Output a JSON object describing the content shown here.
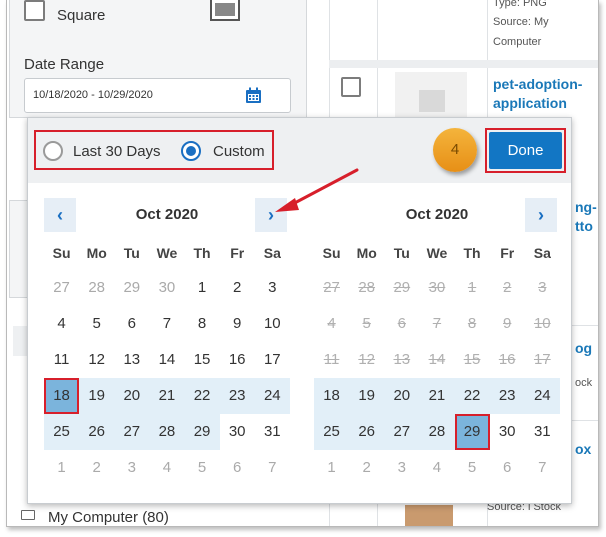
{
  "filters": {
    "square_label": "Square",
    "date_range_label": "Date Range",
    "date_range_value": "10/18/2020 - 10/29/2020",
    "my_computer_label": "My Computer (80)"
  },
  "files": {
    "row1_type": "Type: PNG",
    "row1_source": "Source: My",
    "row1_source2": "Computer",
    "row2_name_line1": "pet-adoption-",
    "row2_name_line2": "application",
    "row3_name_line1": "ng-",
    "row3_name_line2": "tto",
    "row4_name": "og",
    "row4_meta": "ock",
    "row5_name": "ox",
    "row5_meta": "Source: i Stock"
  },
  "picker": {
    "range_options": [
      {
        "label": "Last 30 Days",
        "selected": false
      },
      {
        "label": "Custom",
        "selected": true
      }
    ],
    "step_number": "4",
    "done_label": "Done",
    "prev_glyph": "‹",
    "next_glyph": "›",
    "weekdays": [
      "Su",
      "Mo",
      "Tu",
      "We",
      "Th",
      "Fr",
      "Sa"
    ],
    "months": [
      {
        "title": "Oct 2020",
        "weeks": [
          [
            {
              "d": "27",
              "s": "muted"
            },
            {
              "d": "28",
              "s": "muted"
            },
            {
              "d": "29",
              "s": "muted"
            },
            {
              "d": "30",
              "s": "muted"
            },
            {
              "d": "1",
              "s": ""
            },
            {
              "d": "2",
              "s": ""
            },
            {
              "d": "3",
              "s": ""
            }
          ],
          [
            {
              "d": "4",
              "s": ""
            },
            {
              "d": "5",
              "s": ""
            },
            {
              "d": "6",
              "s": ""
            },
            {
              "d": "7",
              "s": ""
            },
            {
              "d": "8",
              "s": ""
            },
            {
              "d": "9",
              "s": ""
            },
            {
              "d": "10",
              "s": ""
            }
          ],
          [
            {
              "d": "11",
              "s": ""
            },
            {
              "d": "12",
              "s": ""
            },
            {
              "d": "13",
              "s": ""
            },
            {
              "d": "14",
              "s": ""
            },
            {
              "d": "15",
              "s": ""
            },
            {
              "d": "16",
              "s": ""
            },
            {
              "d": "17",
              "s": ""
            }
          ],
          [
            {
              "d": "18",
              "s": "sel"
            },
            {
              "d": "19",
              "s": "range"
            },
            {
              "d": "20",
              "s": "range"
            },
            {
              "d": "21",
              "s": "range"
            },
            {
              "d": "22",
              "s": "range"
            },
            {
              "d": "23",
              "s": "range"
            },
            {
              "d": "24",
              "s": "range"
            }
          ],
          [
            {
              "d": "25",
              "s": "range"
            },
            {
              "d": "26",
              "s": "range"
            },
            {
              "d": "27",
              "s": "range"
            },
            {
              "d": "28",
              "s": "range"
            },
            {
              "d": "29",
              "s": "range"
            },
            {
              "d": "30",
              "s": ""
            },
            {
              "d": "31",
              "s": ""
            }
          ],
          [
            {
              "d": "1",
              "s": "muted"
            },
            {
              "d": "2",
              "s": "muted"
            },
            {
              "d": "3",
              "s": "muted"
            },
            {
              "d": "4",
              "s": "muted"
            },
            {
              "d": "5",
              "s": "muted"
            },
            {
              "d": "6",
              "s": "muted"
            },
            {
              "d": "7",
              "s": "muted"
            }
          ]
        ]
      },
      {
        "title": "Oct 2020",
        "weeks": [
          [
            {
              "d": "27",
              "s": "struck"
            },
            {
              "d": "28",
              "s": "struck"
            },
            {
              "d": "29",
              "s": "struck"
            },
            {
              "d": "30",
              "s": "struck"
            },
            {
              "d": "1",
              "s": "struck"
            },
            {
              "d": "2",
              "s": "struck"
            },
            {
              "d": "3",
              "s": "struck"
            }
          ],
          [
            {
              "d": "4",
              "s": "struck"
            },
            {
              "d": "5",
              "s": "struck"
            },
            {
              "d": "6",
              "s": "struck"
            },
            {
              "d": "7",
              "s": "struck"
            },
            {
              "d": "8",
              "s": "struck"
            },
            {
              "d": "9",
              "s": "struck"
            },
            {
              "d": "10",
              "s": "struck"
            }
          ],
          [
            {
              "d": "11",
              "s": "struck"
            },
            {
              "d": "12",
              "s": "struck"
            },
            {
              "d": "13",
              "s": "struck"
            },
            {
              "d": "14",
              "s": "struck"
            },
            {
              "d": "15",
              "s": "struck"
            },
            {
              "d": "16",
              "s": "struck"
            },
            {
              "d": "17",
              "s": "struck"
            }
          ],
          [
            {
              "d": "18",
              "s": "range"
            },
            {
              "d": "19",
              "s": "range"
            },
            {
              "d": "20",
              "s": "range"
            },
            {
              "d": "21",
              "s": "range"
            },
            {
              "d": "22",
              "s": "range"
            },
            {
              "d": "23",
              "s": "range"
            },
            {
              "d": "24",
              "s": "range"
            }
          ],
          [
            {
              "d": "25",
              "s": "range"
            },
            {
              "d": "26",
              "s": "range"
            },
            {
              "d": "27",
              "s": "range"
            },
            {
              "d": "28",
              "s": "range"
            },
            {
              "d": "29",
              "s": "sel"
            },
            {
              "d": "30",
              "s": ""
            },
            {
              "d": "31",
              "s": ""
            }
          ],
          [
            {
              "d": "1",
              "s": "muted"
            },
            {
              "d": "2",
              "s": "muted"
            },
            {
              "d": "3",
              "s": "muted"
            },
            {
              "d": "4",
              "s": "muted"
            },
            {
              "d": "5",
              "s": "muted"
            },
            {
              "d": "6",
              "s": "muted"
            },
            {
              "d": "7",
              "s": "muted"
            }
          ]
        ]
      }
    ]
  },
  "colors": {
    "accent": "#1276c4",
    "highlight": "#d71f2b",
    "range_fill": "#e2eff8",
    "selected_fill": "#7bb4dc",
    "badge": "#f0a32a"
  },
  "icons": [
    "calendar-icon",
    "chevron-left-icon",
    "chevron-right-icon",
    "arrow-annotation-icon",
    "monitor-icon",
    "document-icon"
  ]
}
